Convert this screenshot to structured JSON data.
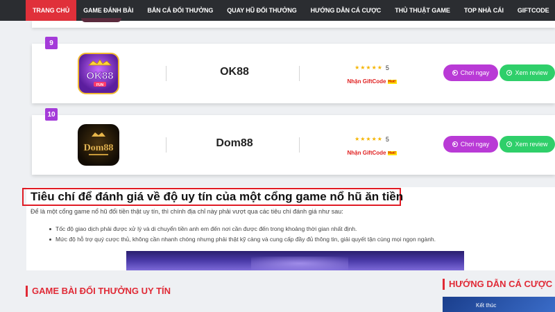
{
  "nav": {
    "items": [
      "TRANG CHỦ",
      "GAME ĐÁNH BÀI",
      "BẮN CÁ ĐỔI THƯỞNG",
      "QUAY HŨ ĐỔI THƯỞNG",
      "HƯỚNG DẪN CÁ CƯỢC",
      "THỦ THUẬT GAME",
      "TOP NHÀ CÁI",
      "GIFTCODE"
    ],
    "active_index": 0
  },
  "colors": {
    "accent": "#e0303a",
    "purple": "#b93ad6",
    "green": "#2fcf6a",
    "star": "#f5b400"
  },
  "cards": [
    {
      "rank": "9",
      "name": "OK88",
      "logo_text": "OK88",
      "logo_sub": "FUN",
      "rating": "5",
      "stars": 5,
      "gift_label": "Nhận GiftCode",
      "hot_label": "Hot!",
      "play_label": "Chơi ngay",
      "review_label": "Xem review"
    },
    {
      "rank": "10",
      "name": "Dom88",
      "logo_text": "Dom88",
      "rating": "5",
      "stars": 5,
      "gift_label": "Nhận GiftCode",
      "hot_label": "Hot!",
      "play_label": "Chơi ngay",
      "review_label": "Xem review"
    }
  ],
  "article": {
    "heading": "Tiêu chí để đánh giá về độ uy tín của một cổng game nổ hũ ăn tiền",
    "intro": "Để là một cổng game nổ hũ đổi tiền thật uy tín, thì chính địa chỉ này phải vượt qua các tiêu chí đánh giá như sau:",
    "bullets": [
      "Tốc độ giao dịch phải được xử lý và di chuyển tiền anh em đến nơi cần được đến trong khoảng thời gian nhất định.",
      "Mức độ hỗ trợ quý cược thủ, không cần nhanh chóng nhưng phải thật kỹ càng và cung cấp đầy đủ thông tin, giải quyết tận cùng mọi ngọn ngành."
    ]
  },
  "sections": {
    "left_title": "GAME BÀI ĐỔI THƯỞNG UY TÍN",
    "right_title": "HƯỚNG DẪN CÁ CƯỢC",
    "right_thumb_text": "Kết thúc"
  }
}
